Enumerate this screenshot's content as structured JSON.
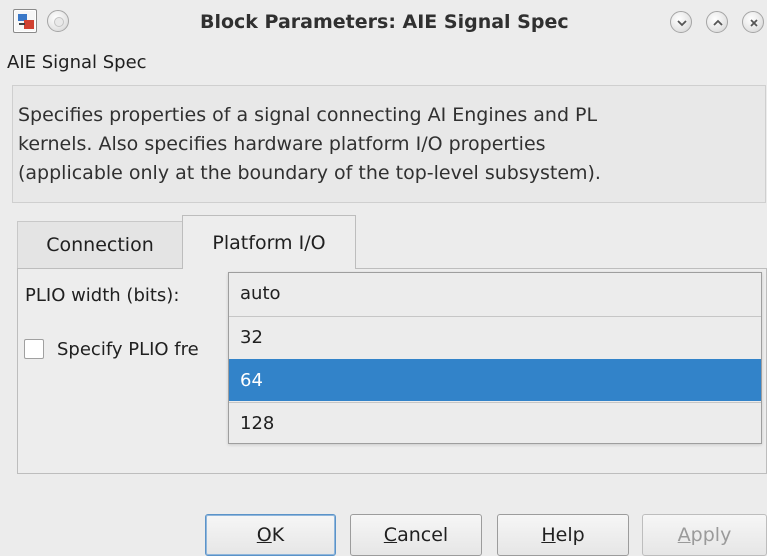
{
  "window": {
    "title": "Block Parameters: AIE Signal Spec",
    "block_name": "AIE Signal Spec"
  },
  "description": {
    "line1": "Specifies properties of a signal connecting AI Engines and PL",
    "line2": "kernels. Also specifies hardware platform I/O properties",
    "line3": "(applicable only at the boundary of the top-level subsystem)."
  },
  "tabs": [
    {
      "label": "Connection",
      "active": false
    },
    {
      "label": "Platform I/O",
      "active": true
    }
  ],
  "platform_io": {
    "plio_width_label": "PLIO width (bits):",
    "specify_freq_label": "Specify PLIO fre",
    "specify_freq_checked": false
  },
  "dropdown": {
    "options": [
      "auto",
      "32",
      "64",
      "128"
    ],
    "highlighted": "64"
  },
  "buttons": {
    "ok": {
      "mnemonic": "O",
      "rest": "K"
    },
    "cancel": {
      "mnemonic": "C",
      "rest": "ancel"
    },
    "help": {
      "mnemonic": "H",
      "rest": "elp"
    },
    "apply": {
      "mnemonic": "A",
      "rest": "pply",
      "enabled": false
    }
  },
  "icons": {
    "app": "simulink-block-icon",
    "minimize": "chevron-down-icon",
    "maximize": "chevron-up-icon",
    "close": "close-icon"
  },
  "colors": {
    "selection": "#3283c9",
    "window_bg": "#ececec"
  }
}
